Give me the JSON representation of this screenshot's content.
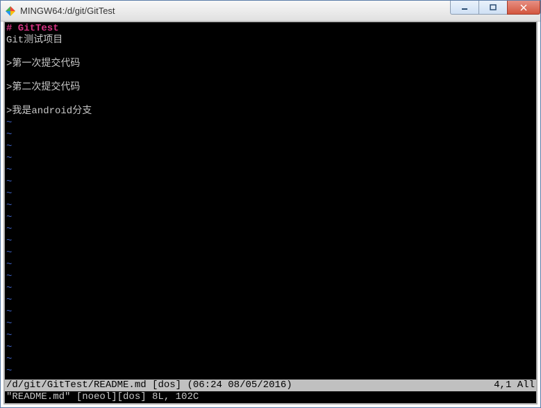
{
  "window": {
    "title": "MINGW64:/d/git/GitTest"
  },
  "content": {
    "heading": "# GitTest",
    "line2": "Git测试项目",
    "line3": "",
    "line4": ">第一次提交代码",
    "line5": "",
    "line6": ">第二次提交代码",
    "line7": "",
    "line8": ">我是android分支"
  },
  "status": {
    "file_path": "/d/git/GitTest/README.md",
    "format": "[dos]",
    "datetime": "(06:24 08/05/2016)",
    "position": "4,1",
    "scroll": "All"
  },
  "message": {
    "text": "\"README.md\" [noeol][dos] 8L, 102C"
  },
  "tilde": "~"
}
